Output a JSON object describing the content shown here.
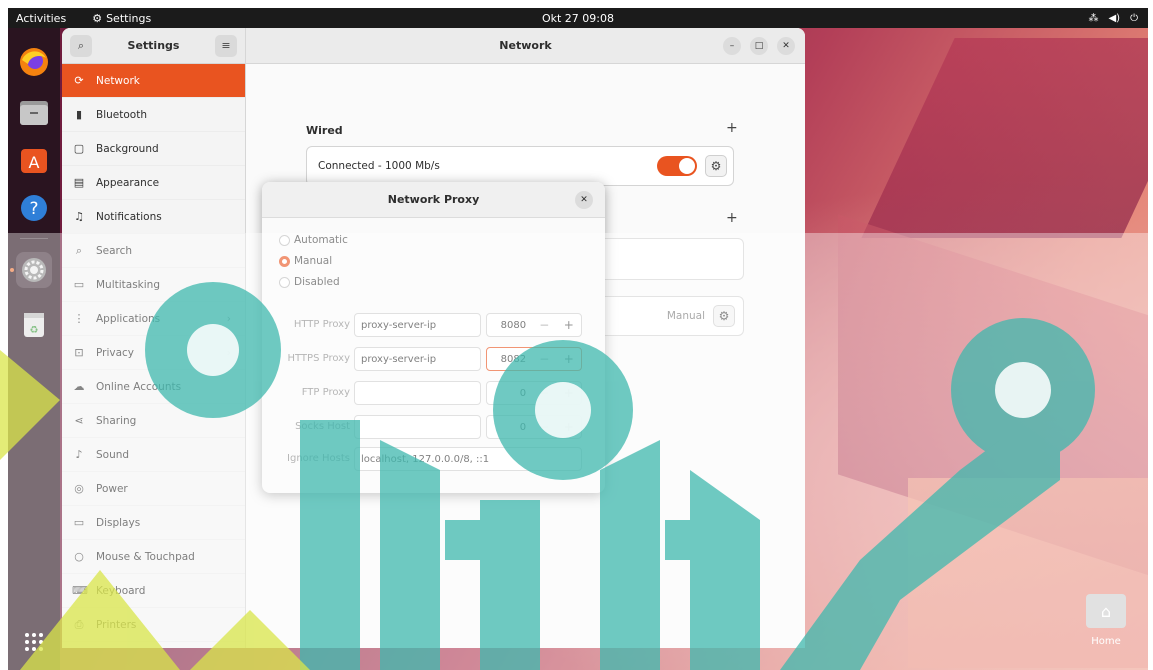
{
  "topbar": {
    "activities": "Activities",
    "app_name": "Settings",
    "clock": "Okt 27  09:08",
    "tray_icons": [
      "network-icon",
      "volume-icon",
      "power-icon"
    ]
  },
  "dock": {
    "apps": [
      "firefox-icon",
      "files-icon",
      "software-icon",
      "help-icon",
      "settings-icon",
      "trash-icon"
    ],
    "show_apps_icon": "grid-icon"
  },
  "settings": {
    "sidebar_title": "Settings",
    "main_title": "Network",
    "sidebar_items": [
      {
        "label": "Network",
        "icon": "network-icon",
        "active": true
      },
      {
        "label": "Bluetooth",
        "icon": "bluetooth-icon"
      },
      {
        "label": "Background",
        "icon": "background-icon"
      },
      {
        "label": "Appearance",
        "icon": "appearance-icon"
      },
      {
        "label": "Notifications",
        "icon": "bell-icon"
      },
      {
        "label": "Search",
        "icon": "search-icon"
      },
      {
        "label": "Multitasking",
        "icon": "multitasking-icon"
      },
      {
        "label": "Applications",
        "icon": "applications-icon",
        "chevron": true
      },
      {
        "label": "Privacy",
        "icon": "privacy-icon",
        "chevron": true
      },
      {
        "label": "Online Accounts",
        "icon": "cloud-icon"
      },
      {
        "label": "Sharing",
        "icon": "share-icon"
      },
      {
        "label": "Sound",
        "icon": "music-icon"
      },
      {
        "label": "Power",
        "icon": "power-icon"
      },
      {
        "label": "Displays",
        "icon": "display-icon"
      },
      {
        "label": "Mouse & Touchpad",
        "icon": "mouse-icon"
      },
      {
        "label": "Keyboard",
        "icon": "keyboard-icon"
      },
      {
        "label": "Printers",
        "icon": "printer-icon"
      }
    ],
    "wired": {
      "title": "Wired",
      "status": "Connected - 1000 Mb/s",
      "enabled": true
    },
    "proxy_row": {
      "value": "Manual"
    }
  },
  "proxy_dialog": {
    "title": "Network Proxy",
    "modes": [
      {
        "label": "Automatic",
        "selected": false
      },
      {
        "label": "Manual",
        "selected": true
      },
      {
        "label": "Disabled",
        "selected": false
      }
    ],
    "rows": [
      {
        "label": "HTTP Proxy",
        "host": "proxy-server-ip",
        "port": "8080"
      },
      {
        "label": "HTTPS Proxy",
        "host": "proxy-server-ip",
        "port": "8082"
      },
      {
        "label": "FTP Proxy",
        "host": "",
        "port": "0"
      },
      {
        "label": "Socks Host",
        "host": "",
        "port": "0"
      }
    ],
    "ignore_label": "Ignore Hosts",
    "ignore_value": "localhost, 127.0.0.0/8, ::1"
  },
  "desktop": {
    "home_label": "Home"
  },
  "colors": {
    "accent": "#e95420",
    "topbar": "#1b1b1b",
    "watermark_teal": "#3fb8ae",
    "watermark_lime": "#d9e64a"
  }
}
